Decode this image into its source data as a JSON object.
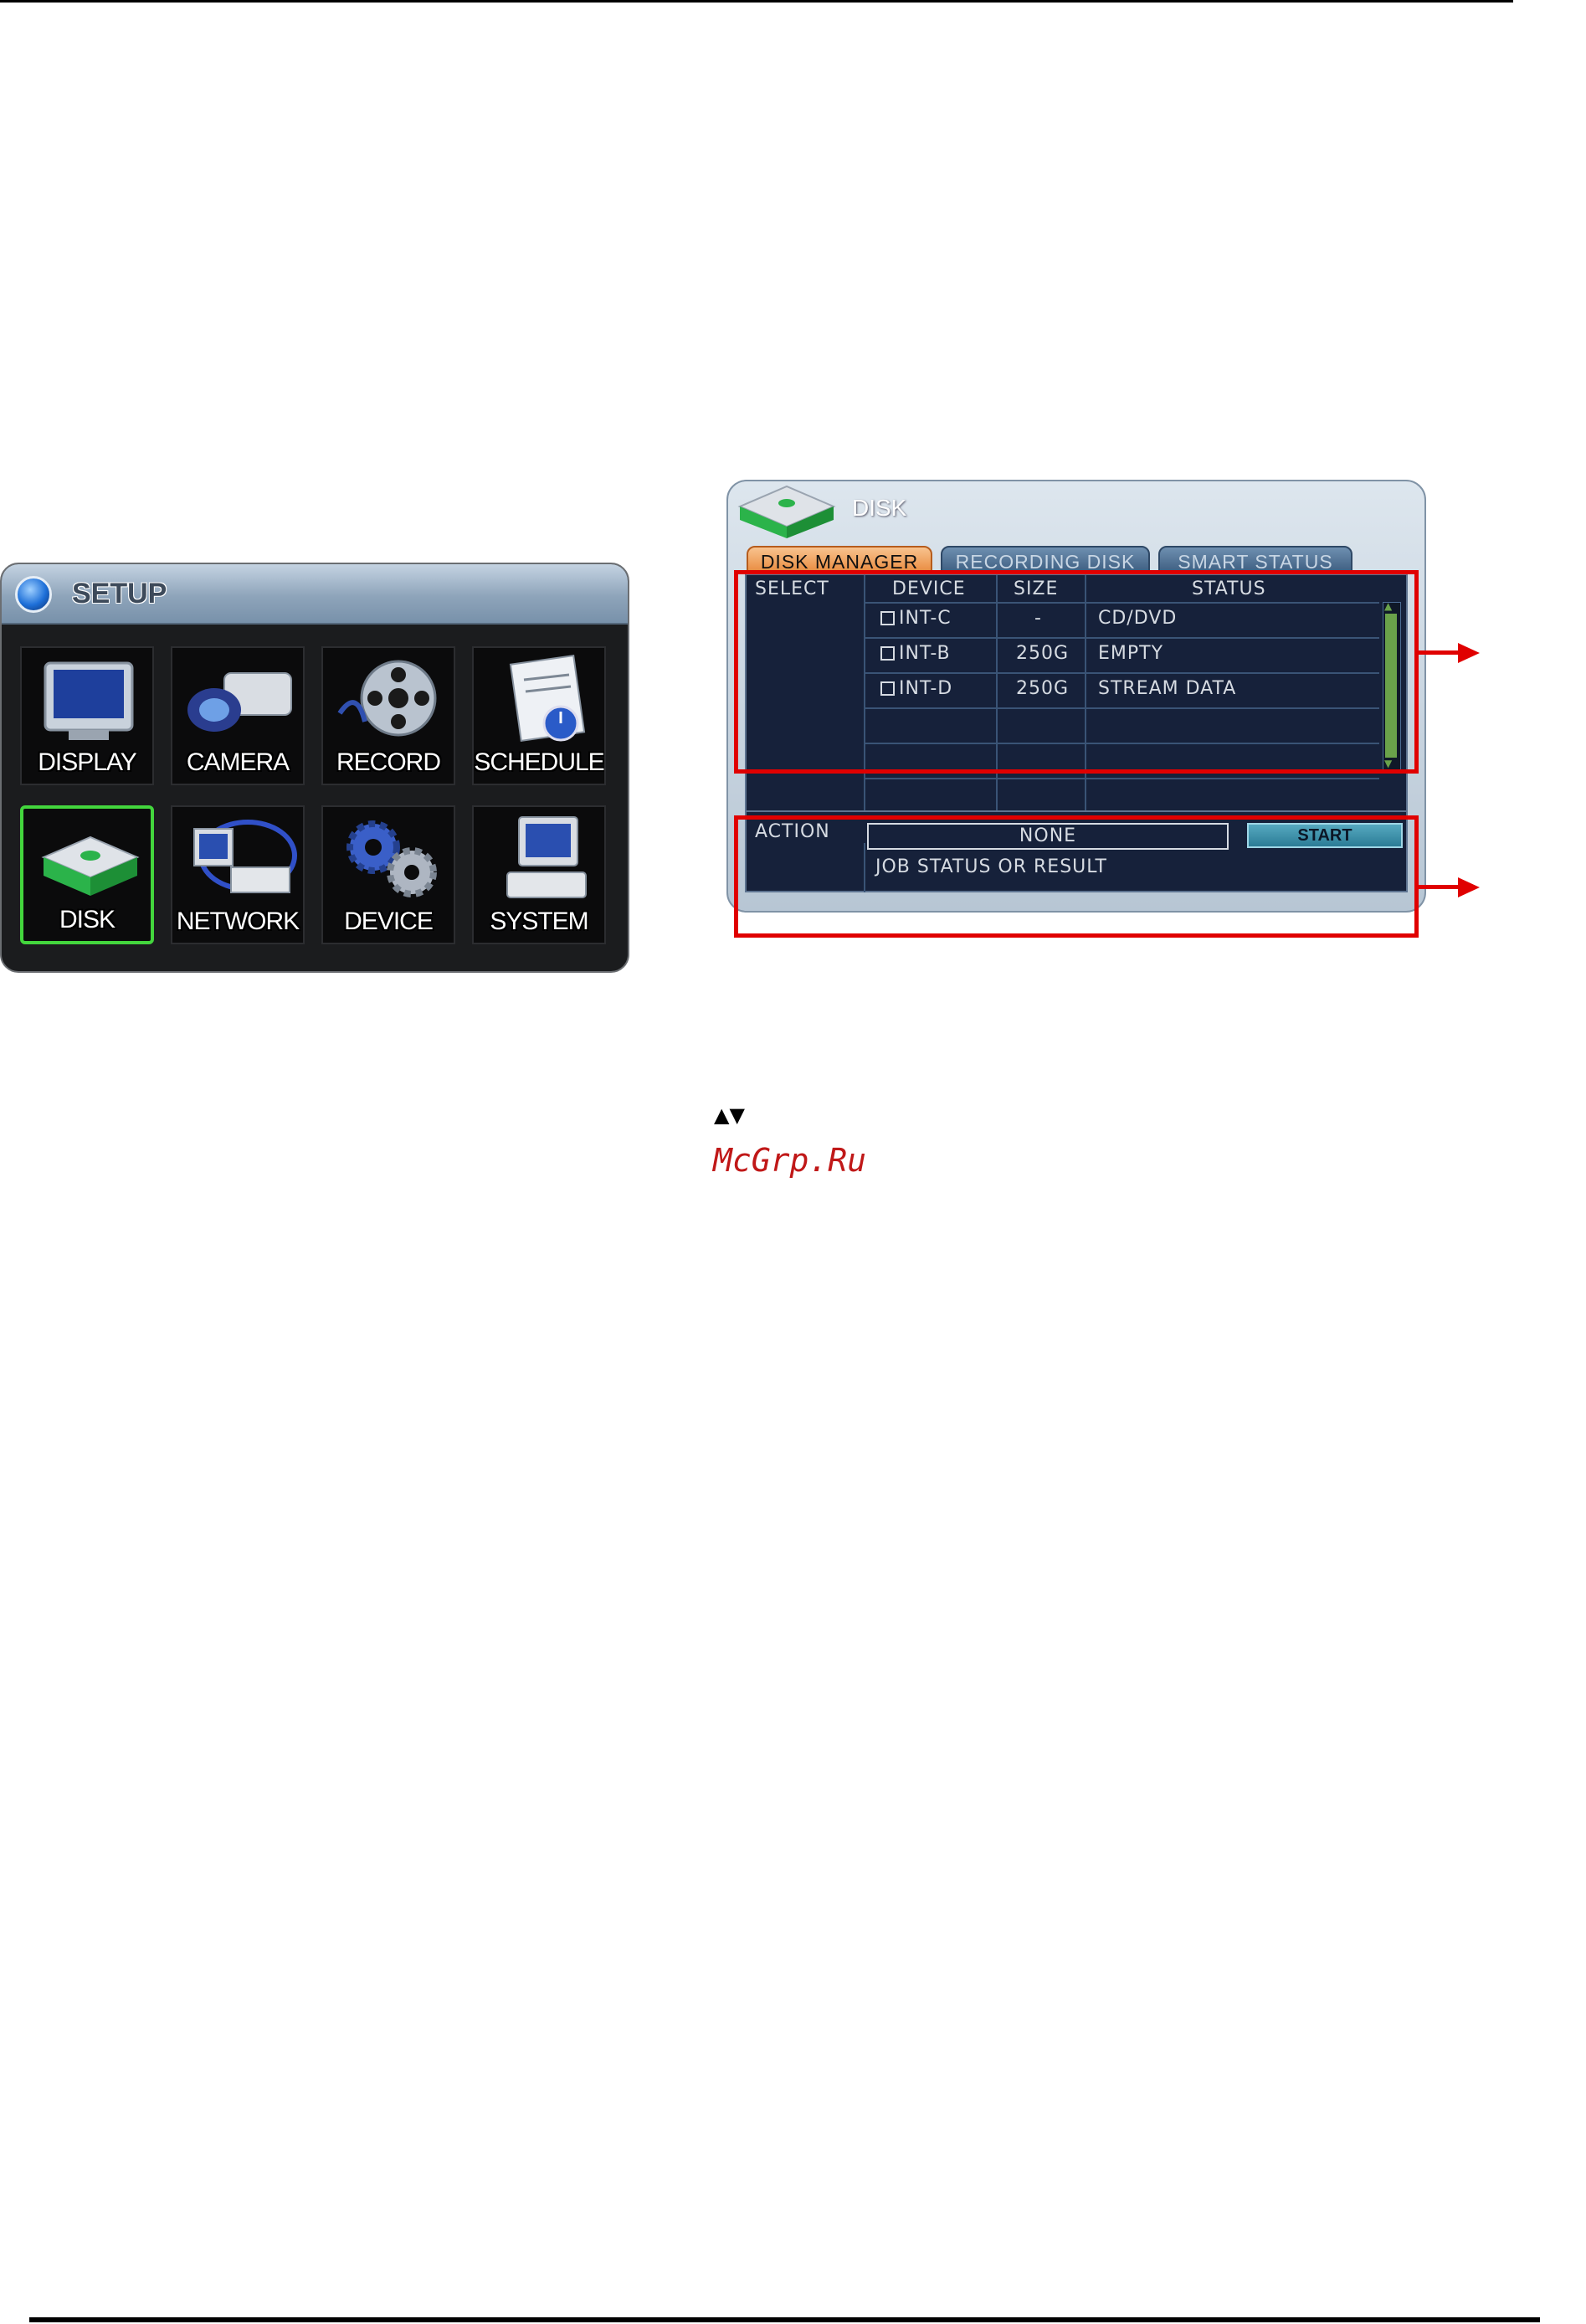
{
  "setup": {
    "title": "SETUP",
    "tiles": [
      {
        "label": "DISPLAY",
        "icon": "monitor-icon"
      },
      {
        "label": "CAMERA",
        "icon": "camera-icon"
      },
      {
        "label": "RECORD",
        "icon": "film-reel-icon"
      },
      {
        "label": "SCHEDULE",
        "icon": "schedule-clock-icon"
      },
      {
        "label": "DISK",
        "icon": "disk-drive-icon",
        "selected": true
      },
      {
        "label": "NETWORK",
        "icon": "network-icon"
      },
      {
        "label": "DEVICE",
        "icon": "gears-icon"
      },
      {
        "label": "SYSTEM",
        "icon": "computer-icon"
      }
    ]
  },
  "disk": {
    "title": "DISK",
    "tabs": [
      {
        "label": "DISK MANAGER",
        "active": true
      },
      {
        "label": "RECORDING DISK",
        "active": false
      },
      {
        "label": "SMART STATUS",
        "active": false
      }
    ],
    "columns": {
      "select": "SELECT",
      "device": "DEVICE",
      "size": "SIZE",
      "status": "STATUS"
    },
    "rows": [
      {
        "device": "INT-C",
        "size": "-",
        "status": "CD/DVD",
        "checked": false
      },
      {
        "device": "INT-B",
        "size": "250G",
        "status": "EMPTY",
        "checked": false
      },
      {
        "device": "INT-D",
        "size": "250G",
        "status": "STREAM DATA",
        "checked": false
      }
    ],
    "action_label": "ACTION",
    "action_value": "NONE",
    "start_label": "START",
    "job_status": "JOB STATUS OR RESULT"
  },
  "footer": {
    "arrows": "▲▼",
    "watermark": "McGrp.Ru"
  },
  "colors": {
    "annotation": "#e00000",
    "selection": "#43d63d",
    "watermark": "#c01818"
  }
}
